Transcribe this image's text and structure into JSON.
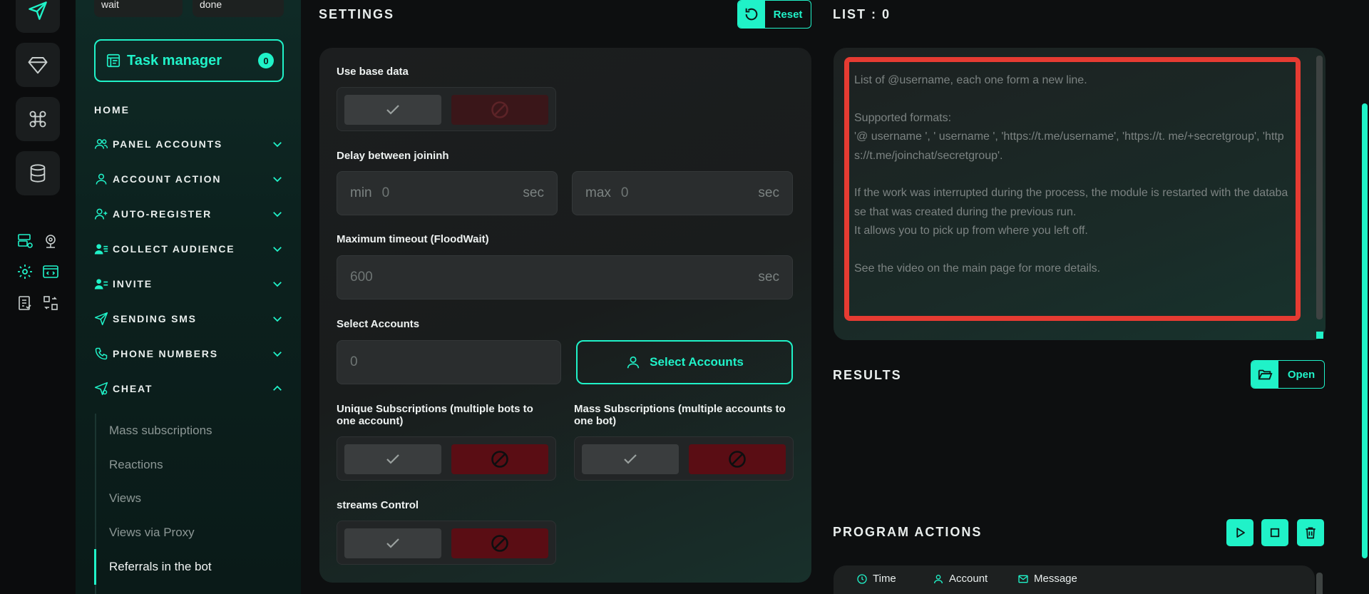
{
  "sidebar": {
    "status_left": "wait",
    "status_right": "done",
    "task_manager_label": "Task manager",
    "task_manager_count": "0",
    "home": "HOME",
    "nav": [
      {
        "label": "PANEL ACCOUNTS"
      },
      {
        "label": "ACCOUNT ACTION"
      },
      {
        "label": "AUTO-REGISTER"
      },
      {
        "label": "COLLECT AUDIENCE"
      },
      {
        "label": "INVITE"
      },
      {
        "label": "SENDING SMS"
      },
      {
        "label": "PHONE NUMBERS"
      },
      {
        "label": "CHEAT"
      }
    ],
    "cheat_sub": [
      "Mass subscriptions",
      "Reactions",
      "Views",
      "Views via Proxy",
      "Referrals in the bot"
    ]
  },
  "settings": {
    "title": "SETTINGS",
    "reset_label": "Reset",
    "use_base_data_label": "Use base data",
    "delay_label": "Delay between joininh",
    "delay_min_prefix": "min",
    "delay_min_value": "0",
    "delay_max_prefix": "max",
    "delay_max_value": "0",
    "unit_sec": "sec",
    "timeout_label": "Maximum timeout (FloodWait)",
    "timeout_value": "600",
    "select_accounts_label": "Select Accounts",
    "select_accounts_value": "0",
    "select_accounts_button": "Select Accounts",
    "unique_subs_label": "Unique Subscriptions (multiple bots to one account)",
    "mass_subs_label": "Mass Subscriptions (multiple accounts to one bot)",
    "streams_label": "streams Control"
  },
  "list": {
    "title": "LIST : 0",
    "placeholder": "List of @username, each one form a new line.\n\nSupported formats:\n'@ username ', ' username ', 'https://t.me/username', 'https://t. me/+secretgroup', 'https://t.me/joinchat/secretgroup'.\n\nIf the work was interrupted during the process, the module is restarted with the database that was created during the previous run.\nIt allows you to pick up from where you left off.\n\nSee the video on the main page for more details."
  },
  "results": {
    "title": "RESULTS",
    "open_label": "Open"
  },
  "program_actions": {
    "title": "PROGRAM ACTIONS",
    "col_time": "Time",
    "col_account": "Account",
    "col_message": "Message"
  },
  "colors": {
    "accent": "#20f2c8",
    "danger": "#5a0d14",
    "highlight_border": "#e63b32"
  }
}
